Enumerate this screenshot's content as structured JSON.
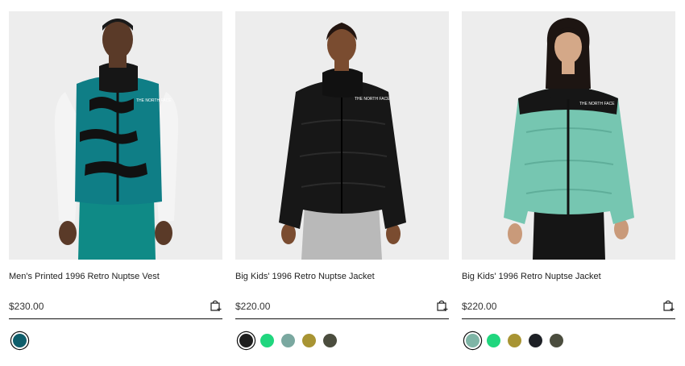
{
  "products": [
    {
      "name": "Men's Printed 1996 Retro Nuptse Vest",
      "price": "$230.00",
      "swatches": [
        {
          "color": "#0f5e6b",
          "selected": true
        }
      ]
    },
    {
      "name": "Big Kids' 1996 Retro Nuptse Jacket",
      "price": "$220.00",
      "swatches": [
        {
          "color": "#1e1e1e",
          "selected": true
        },
        {
          "color": "#20d67e",
          "selected": false
        },
        {
          "color": "#7aa8a0",
          "selected": false
        },
        {
          "color": "#a89433",
          "selected": false
        },
        {
          "color": "#4b4d3e",
          "selected": false
        }
      ]
    },
    {
      "name": "Big Kids' 1996 Retro Nuptse Jacket",
      "price": "$220.00",
      "swatches": [
        {
          "color": "#7fb5a6",
          "selected": true
        },
        {
          "color": "#20d67e",
          "selected": false
        },
        {
          "color": "#a89433",
          "selected": false
        },
        {
          "color": "#1e2126",
          "selected": false
        },
        {
          "color": "#4b4d3e",
          "selected": false
        }
      ]
    }
  ],
  "icons": {
    "cart": "add-to-cart-bag-icon"
  },
  "brand_logo_text": "THE NORTH FACE"
}
